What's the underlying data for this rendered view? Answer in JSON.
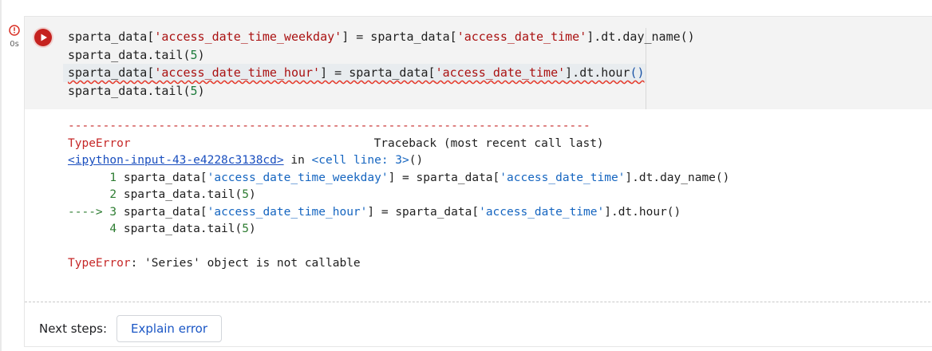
{
  "status": {
    "time": "0s",
    "icon": "error-icon",
    "error_color": "#d93025"
  },
  "run_button": {
    "icon": "play-icon",
    "color": "#c5221f"
  },
  "code": {
    "line1": {
      "a": "sparta_data[",
      "s1": "'access_date_time_weekday'",
      "b": "] = sparta_data[",
      "s2": "'access_date_time'",
      "c": "].dt.day_name()"
    },
    "line2": {
      "a": "sparta_data.tail(",
      "n": "5",
      "b": ")"
    },
    "line3": {
      "a": "sparta_data[",
      "s1": "'access_date_time_hour'",
      "b": "] = sparta_data[",
      "s2": "'access_date_time'",
      "c": "].dt.hour",
      "p": "()"
    },
    "line4": {
      "a": "sparta_data.tail(",
      "n": "5",
      "b": ")"
    }
  },
  "traceback": {
    "separator": "---------------------------------------------------------------------------",
    "error_type": "TypeError",
    "header_right": "Traceback (most recent call last)",
    "link": "<ipython-input-43-e4228c3138cd>",
    "in_text": " in ",
    "cell_line": "<cell line: 3>",
    "cell_parens": "()",
    "l1": {
      "prefix": "      1 ",
      "a": "sparta_data[",
      "s1": "'access_date_time_weekday'",
      "b": "] = sparta_data[",
      "s2": "'access_date_time'",
      "c": "].dt.day_name()"
    },
    "l2": {
      "prefix": "      2 ",
      "a": "sparta_data.tail(",
      "n": "5",
      "b": ")"
    },
    "l3": {
      "prefix": "----> 3 ",
      "a": "sparta_data[",
      "s1": "'access_date_time_hour'",
      "b": "] = sparta_data[",
      "s2": "'access_date_time'",
      "c": "].dt.hour()"
    },
    "l4": {
      "prefix": "      4 ",
      "a": "sparta_data.tail(",
      "n": "5",
      "b": ")"
    },
    "final_type": "TypeError",
    "final_msg": ": 'Series' object is not callable"
  },
  "next_steps": {
    "label": "Next steps:",
    "button": "Explain error"
  }
}
